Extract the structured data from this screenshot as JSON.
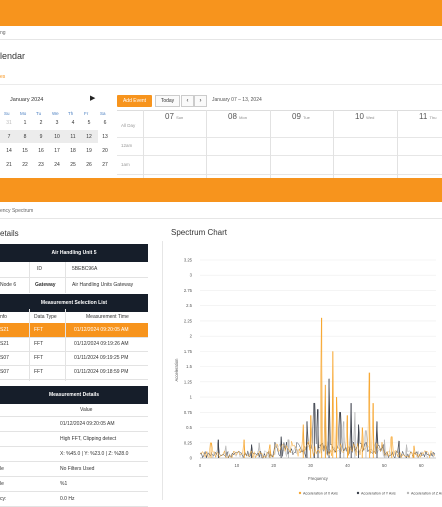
{
  "crumb_top": "ng",
  "calendar": {
    "title": "lendar",
    "subtitle": "es",
    "month_label": "January 2024",
    "next_icon": "▶",
    "dow": [
      "Su",
      "Mo",
      "Tu",
      "We",
      "Th",
      "Fr",
      "Sa"
    ],
    "weeks": [
      [
        "31",
        "1",
        "2",
        "3",
        "4",
        "5",
        "6"
      ],
      [
        "7",
        "8",
        "9",
        "10",
        "11",
        "12",
        "13"
      ],
      [
        "14",
        "15",
        "16",
        "17",
        "18",
        "19",
        "20"
      ],
      [
        "21",
        "22",
        "23",
        "24",
        "25",
        "26",
        "27"
      ]
    ]
  },
  "schedule": {
    "add_event": "Add Event",
    "today": "Today",
    "prev": "‹",
    "next": "›",
    "range": "January 07 – 13, 2024",
    "all_day": "All Day",
    "row_labels": [
      "12am",
      "1am"
    ],
    "days": [
      {
        "num": "07",
        "name": "Sun"
      },
      {
        "num": "08",
        "name": "Mon"
      },
      {
        "num": "09",
        "name": "Tue"
      },
      {
        "num": "10",
        "name": "Wed"
      },
      {
        "num": "11",
        "name": "Thu"
      }
    ]
  },
  "crumb_bottom": "ency Spectrum",
  "details": {
    "title": "etails",
    "unit_header": "Air Handling Unit 5",
    "id_label": "ID",
    "id_value": "5BEBC96A",
    "gateway_label": "Gateway",
    "gateway_value": "Air Handling Units Gateway",
    "node_value": "Node 6",
    "selection_header": "Measurement Selection List",
    "col_info": "nfo",
    "col_type": "Data Type",
    "col_time": "Measurement Time",
    "rows": [
      {
        "info": "S21",
        "type": "FFT",
        "time": "01/12/2024 09:20:05 AM",
        "selected": true
      },
      {
        "info": "S21",
        "type": "FFT",
        "time": "01/12/2024 09:19:26 AM",
        "selected": false
      },
      {
        "info": "S07",
        "type": "FFT",
        "time": "01/11/2024 09:19:25 PM",
        "selected": false
      },
      {
        "info": "S07",
        "type": "FFT",
        "time": "01/11/2024 09:18:59 PM",
        "selected": false
      }
    ],
    "measure_header": "Measurement Details",
    "value_header": "Value",
    "values": [
      {
        "label": "",
        "value": "01/12/2024 09:20:05 AM"
      },
      {
        "label": "",
        "value": "High FFT, Clipping detect"
      },
      {
        "label": "",
        "value": "X: %45.0 | Y: %23.0 | Z: %28.0"
      },
      {
        "label": "le",
        "value": "No Filters Used"
      },
      {
        "label": "le",
        "value": "%1"
      },
      {
        "label": "cy:",
        "value": "0.0 Hz"
      }
    ]
  },
  "chart": {
    "title": "Spectrum Chart",
    "legend": [
      "Acceleration of X Axis",
      "Acceleration of Y Axis",
      "Acceleration of Z Axis"
    ]
  },
  "chart_data": {
    "type": "line",
    "xlabel": "Frequency",
    "ylabel": "Acceleration",
    "ylim": [
      0,
      3.25
    ],
    "yticks": [
      "0",
      "0.25",
      "0.5",
      "0.75",
      "1",
      "1.25",
      "1.5",
      "1.75",
      "2",
      "2.25",
      "2.5",
      "2.75",
      "3",
      "3.25"
    ],
    "xticks": [
      "0",
      "10",
      "20",
      "30",
      "40",
      "50",
      "60"
    ],
    "colors": {
      "x": "#f7a833",
      "y": "#3a3f4a",
      "z": "#b8b8b8"
    },
    "series": [
      {
        "name": "Acceleration of X Axis",
        "peaks": [
          [
            3,
            0.25
          ],
          [
            12,
            0.3
          ],
          [
            19,
            0.22
          ],
          [
            28,
            0.55
          ],
          [
            30,
            0.7
          ],
          [
            33,
            2.3
          ],
          [
            34,
            1.2
          ],
          [
            36,
            1.75
          ],
          [
            37,
            1.0
          ],
          [
            40,
            0.7
          ],
          [
            44,
            0.5
          ],
          [
            46,
            1.4
          ],
          [
            47,
            0.9
          ],
          [
            52,
            0.35
          ],
          [
            58,
            0.2
          ]
        ]
      },
      {
        "name": "Acceleration of Y Axis",
        "peaks": [
          [
            5,
            0.3
          ],
          [
            14,
            0.22
          ],
          [
            22,
            0.35
          ],
          [
            29,
            0.6
          ],
          [
            31,
            0.9
          ],
          [
            32,
            0.8
          ],
          [
            35,
            1.3
          ],
          [
            38,
            0.75
          ],
          [
            41,
            0.9
          ],
          [
            43,
            0.55
          ],
          [
            48,
            0.6
          ],
          [
            54,
            0.28
          ]
        ]
      },
      {
        "name": "Acceleration of Z Axis",
        "peaks": [
          [
            7,
            0.2
          ],
          [
            16,
            0.25
          ],
          [
            24,
            0.3
          ],
          [
            30,
            0.5
          ],
          [
            34,
            0.85
          ],
          [
            39,
            0.6
          ],
          [
            42,
            0.75
          ],
          [
            45,
            0.45
          ],
          [
            50,
            0.3
          ],
          [
            56,
            0.22
          ]
        ]
      }
    ]
  }
}
